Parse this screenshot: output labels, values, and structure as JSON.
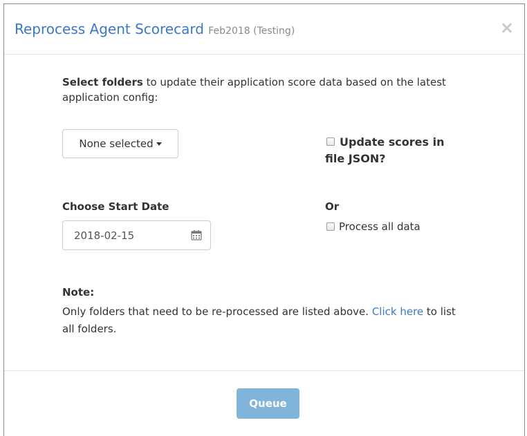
{
  "modal": {
    "title": "Reprocess Agent Scorecard",
    "subtitle": "Feb2018 (Testing)",
    "close_glyph": "×"
  },
  "intro": {
    "bold": "Select folders",
    "rest": " to update their application score data based on the latest application config:"
  },
  "folder_dropdown": {
    "selected": "None selected"
  },
  "update_json": {
    "label": "Update scores in file JSON?",
    "checked": false
  },
  "start_date": {
    "label": "Choose Start Date",
    "value": "2018-02-15",
    "icon": "calendar-icon"
  },
  "or_section": {
    "label": "Or",
    "process_all_label": "Process all data",
    "checked": false
  },
  "note": {
    "heading": "Note:",
    "text_before": "Only folders that need to be re-processed are listed above. ",
    "link": "Click here",
    "text_after": " to list all folders."
  },
  "footer": {
    "queue_label": "Queue"
  },
  "colors": {
    "title": "#3a78c9",
    "link": "#3a78c9",
    "button_bg": "#80b4db"
  }
}
